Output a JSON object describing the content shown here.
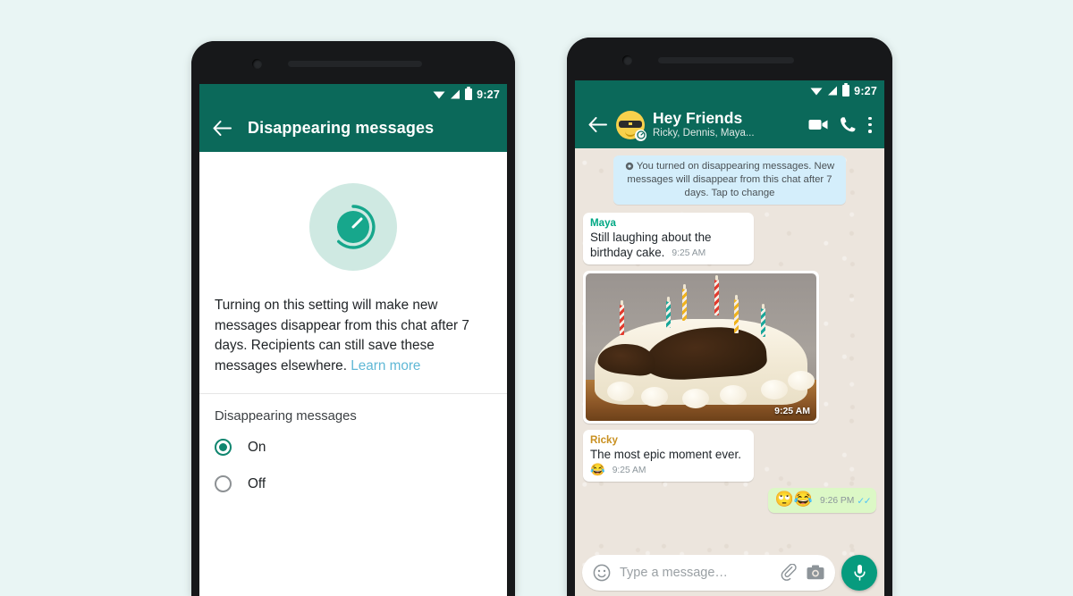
{
  "background_color": "#e9f5f4",
  "accent_color": "#0b695a",
  "left_phone": {
    "status_bar": {
      "time": "9:27",
      "icons": [
        "wifi-icon",
        "signal-icon",
        "battery-icon"
      ]
    },
    "app_bar": {
      "back_icon": "back-arrow-icon",
      "title": "Disappearing messages"
    },
    "hero_icon": "disappearing-timer-icon",
    "description": {
      "text": "Turning on this setting will make new messages disappear from this chat after 7 days. Recipients can still save these messages elsewhere.",
      "link_label": "Learn more",
      "link_color": "#5fb8d6"
    },
    "section_label": "Disappearing messages",
    "options": [
      {
        "label": "On",
        "selected": true
      },
      {
        "label": "Off",
        "selected": false
      }
    ],
    "selected_color": "#0f856f"
  },
  "right_phone": {
    "status_bar": {
      "time": "9:27",
      "icons": [
        "wifi-icon",
        "signal-icon",
        "battery-icon"
      ]
    },
    "app_bar": {
      "back_icon": "back-arrow-icon",
      "avatar": "sunglasses-emoji-avatar",
      "avatar_badge": "timer-badge-icon",
      "title": "Hey Friends",
      "subtitle": "Ricky, Dennis, Maya...",
      "actions": [
        "video-call-icon",
        "phone-call-icon",
        "overflow-menu-icon"
      ]
    },
    "system_notice": {
      "icon": "timer-icon",
      "text": "You turned on disappearing messages. New messages will disappear from this chat after 7 days. Tap to change",
      "background": "#d4eefb"
    },
    "messages": [
      {
        "type": "text",
        "direction": "in",
        "sender": "Maya",
        "sender_color": "#00a884",
        "text": "Still laughing about the birthday cake.",
        "time": "9:25 AM"
      },
      {
        "type": "image",
        "direction": "in",
        "alt": "birthday-cake-photo",
        "time": "9:25 AM"
      },
      {
        "type": "text",
        "direction": "in",
        "sender": "Ricky",
        "sender_color": "#c99020",
        "text": "The most epic moment ever.",
        "emoji": "😂",
        "time": "9:25 AM"
      },
      {
        "type": "emoji",
        "direction": "out",
        "emoji": "🙄😂",
        "time": "9:26 PM",
        "status": "read"
      }
    ],
    "input_bar": {
      "emoji_icon": "emoji-smiley-icon",
      "placeholder": "Type a message…",
      "attach_icon": "paperclip-icon",
      "camera_icon": "camera-icon",
      "mic_icon": "microphone-icon",
      "mic_button_color": "#079b7e"
    }
  }
}
